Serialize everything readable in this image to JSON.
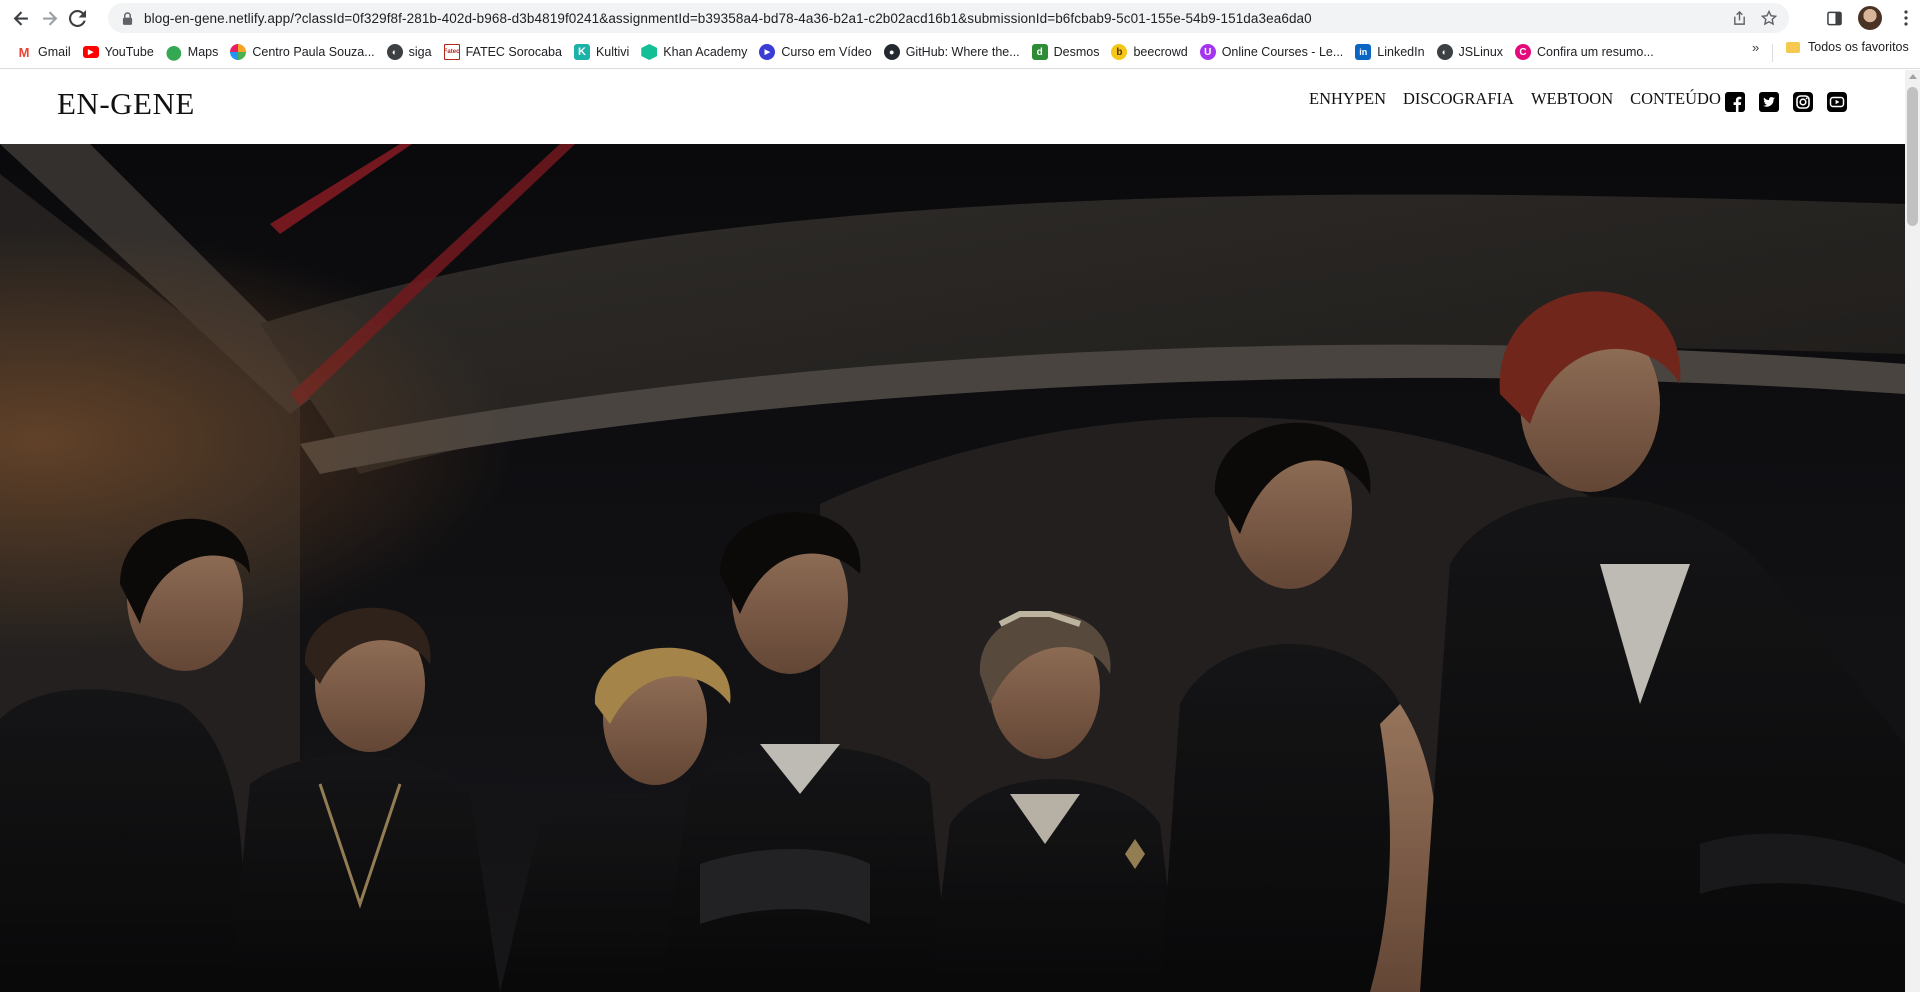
{
  "browser": {
    "url": "blog-en-gene.netlify.app/?classId=0f329f8f-281b-402d-b968-d3b4819f0241&assignmentId=b39358a4-bd78-4a36-b2a1-c2b02acd16b1&submissionId=b6fcbab9-5c01-155e-54b9-151da3ea6da0",
    "icons": {
      "back": "arrow-left-icon",
      "forward": "arrow-right-icon",
      "reload": "reload-icon",
      "lock": "lock-icon",
      "share": "share-icon",
      "bookmark_star": "star-icon",
      "side_panel": "side-panel-icon",
      "menu": "kebab-menu-icon"
    }
  },
  "bookmarks": {
    "items": [
      {
        "label": "Gmail",
        "icon": "gmail-icon",
        "color": "#ea4335"
      },
      {
        "label": "YouTube",
        "icon": "youtube-icon",
        "color": "#ff0000"
      },
      {
        "label": "Maps",
        "icon": "maps-icon",
        "color": "#34a853"
      },
      {
        "label": "Centro Paula Souza...",
        "icon": "paula-souza-icon",
        "color": "#f4a623"
      },
      {
        "label": "siga",
        "icon": "globe-icon",
        "color": "#3c4043"
      },
      {
        "label": "FATEC Sorocaba",
        "icon": "fatec-icon",
        "color": "#b3261e"
      },
      {
        "label": "Kultivi",
        "icon": "kultivi-icon",
        "color": "#1bb3a8"
      },
      {
        "label": "Khan Academy",
        "icon": "khan-academy-icon",
        "color": "#14bf96"
      },
      {
        "label": "Curso em Vídeo",
        "icon": "curso-em-video-icon",
        "color": "#3b3bd6"
      },
      {
        "label": "GitHub: Where the...",
        "icon": "github-icon",
        "color": "#24292f"
      },
      {
        "label": "Desmos",
        "icon": "desmos-icon",
        "color": "#2f8c36"
      },
      {
        "label": "beecrowd",
        "icon": "beecrowd-icon",
        "color": "#6b4f1d"
      },
      {
        "label": "Online Courses - Le...",
        "icon": "udemy-icon",
        "color": "#a435f0"
      },
      {
        "label": "LinkedIn",
        "icon": "linkedin-icon",
        "color": "#0a66c2"
      },
      {
        "label": "JSLinux",
        "icon": "globe-icon",
        "color": "#3c4043"
      },
      {
        "label": "Confira um resumo...",
        "icon": "canva-icon",
        "color": "#e4097c"
      }
    ],
    "more": "»",
    "all_bookmarks": "Todos os favoritos"
  },
  "site": {
    "logo": "EN-GENE",
    "nav": [
      "ENHYPEN",
      "DISCOGRAFIA",
      "WEBTOON",
      "CONTEÚDO"
    ],
    "social": [
      "facebook-icon",
      "twitter-icon",
      "instagram-icon",
      "youtube-icon"
    ],
    "hero_image": "group-photo"
  }
}
